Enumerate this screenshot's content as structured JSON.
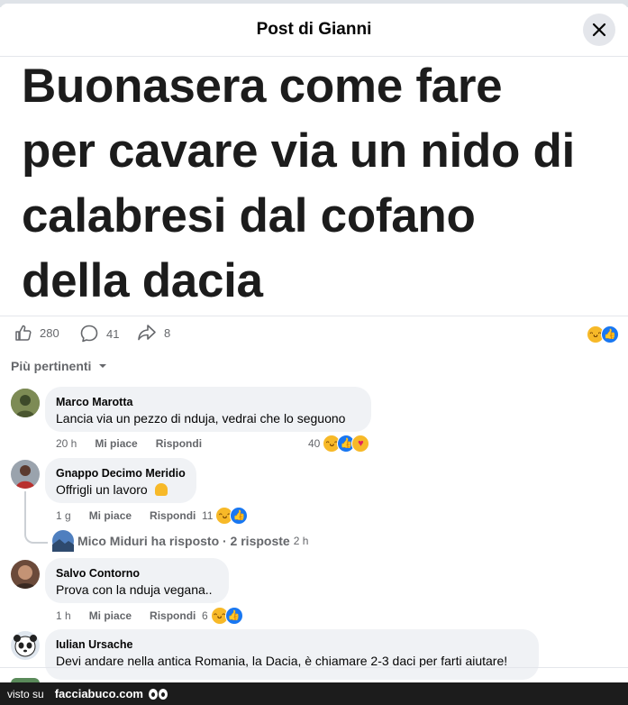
{
  "header": {
    "title": "Post di Gianni"
  },
  "post": {
    "lines": [
      "Buonasera come fare",
      "per cavare via un nido di",
      "calabresi dal cofano",
      "della dacia"
    ]
  },
  "actions": {
    "likes": "280",
    "comments": "41",
    "shares": "8"
  },
  "sort": {
    "label": "Più pertinenti"
  },
  "comments": [
    {
      "name": "Marco Marotta",
      "text": "Lancia via un pezzo di nduja, vedrai che lo seguono",
      "time": "20 h",
      "like": "Mi piace",
      "reply": "Rispondi",
      "reactions": "40"
    },
    {
      "name": "Gnappo Decimo Meridio",
      "text": "Offrigli un lavoro",
      "time": "1 g",
      "like": "Mi piace",
      "reply": "Rispondi",
      "reactions": "11"
    },
    {
      "name": "Salvo Contorno",
      "text": "Prova con la nduja vegana..",
      "time": "1 h",
      "like": "Mi piace",
      "reply": "Rispondi",
      "reactions": "6"
    },
    {
      "name": "Iulian Ursache",
      "text": "Devi andare nella antica Romania, la Dacia, è chiamare 2-3 daci per farti aiutare!"
    }
  ],
  "reply_summary": {
    "text": "Mico Miduri ha risposto · 2 risposte",
    "time": "2 h"
  },
  "footer": {
    "visto": "visto su",
    "brand": "facciabuco.com"
  },
  "colors": {
    "like_blue": "#1877f2",
    "haha_yellow": "#f7b928",
    "bubble_bg": "#f0f2f5",
    "meta_gray": "#65676b"
  }
}
